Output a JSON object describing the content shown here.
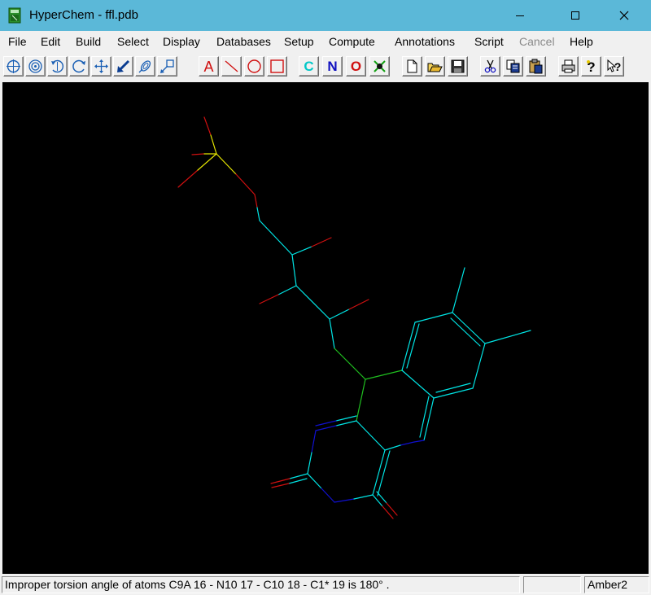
{
  "window": {
    "title": "HyperChem - ffl.pdb"
  },
  "menu": {
    "items": [
      {
        "label": "File"
      },
      {
        "label": "Edit"
      },
      {
        "label": "Build"
      },
      {
        "label": "Select"
      },
      {
        "label": "Display"
      },
      {
        "label": "Databases"
      },
      {
        "label": "Setup"
      },
      {
        "label": "Compute"
      },
      {
        "label": "Annotations"
      },
      {
        "label": "Script"
      },
      {
        "label": "Cancel",
        "enabled": false
      },
      {
        "label": "Help"
      }
    ]
  },
  "toolbar": {
    "drawing_letters": {
      "a": "A",
      "c": "C",
      "n": "N",
      "o": "O"
    },
    "tools": [
      "select-icon",
      "zoom-icon",
      "rotate-xy-icon",
      "rotate-z-icon",
      "translate-xy-icon",
      "translate-z-icon",
      "zoom-in-icon",
      "clip-icon",
      "text-annotation-icon",
      "line-annotation-icon",
      "ellipse-annotation-icon",
      "rectangle-annotation-icon",
      "carbon-icon",
      "nitrogen-icon",
      "oxygen-icon",
      "explicit-hydrogen-icon",
      "new-file-icon",
      "open-file-icon",
      "save-file-icon",
      "cut-icon",
      "copy-icon",
      "paste-icon",
      "print-icon",
      "help-icon",
      "context-help-icon"
    ]
  },
  "colors": {
    "titlebar": "#5bb8d8",
    "workspace": "#000000",
    "carbon": "#00e5e5",
    "nitrogen": "#1010d0",
    "oxygen": "#d01010",
    "phosphorus": "#e6e600",
    "selected": "#20c020"
  },
  "status": {
    "message": "Improper torsion angle of atoms C9A 16 - N10 17 - C10 18 - C1* 19 is 180° .",
    "pane2": "",
    "forcefield": "Amber2"
  }
}
